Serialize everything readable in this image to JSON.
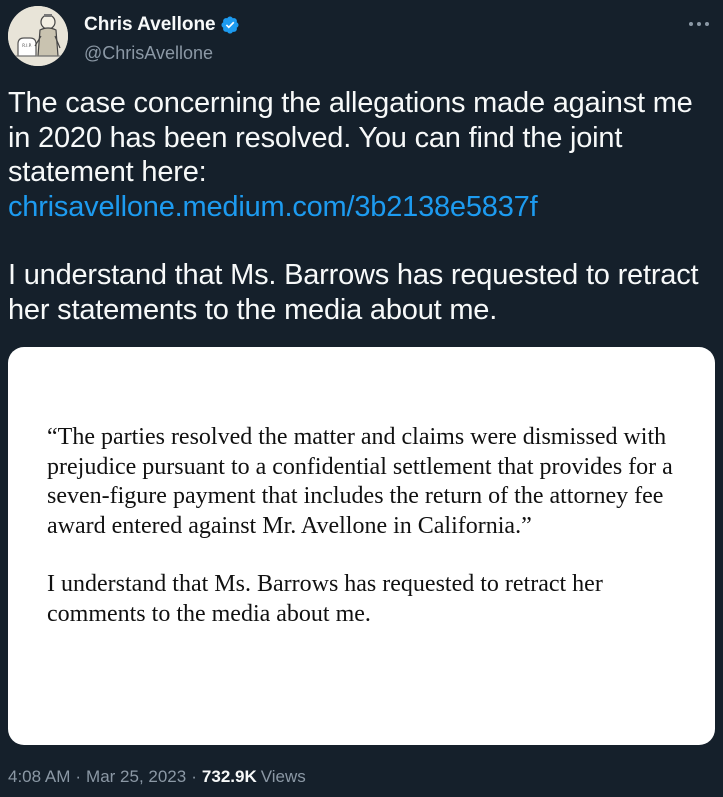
{
  "author": {
    "display_name": "Chris Avellone",
    "handle": "@ChrisAvellone",
    "verified_icon": "verified-badge-icon"
  },
  "tweet": {
    "paragraph1": "The case concerning the allegations made against me in 2020 has been resolved. You can find the joint statement here:",
    "link": "chrisavellone.medium.com/3b2138e5837f",
    "paragraph2": "I understand that Ms. Barrows has requested to retract her statements to the media about me."
  },
  "media": {
    "quote_paragraph1": "“The parties resolved the matter and claims were dismissed with prejudice pursuant to a confidential settlement that provides for a seven-figure payment that includes the return of the attorney fee award entered against Mr. Avellone in California.”",
    "quote_paragraph2": "I understand that Ms. Barrows has requested to retract her comments to the media about me."
  },
  "meta": {
    "time": "4:08 AM",
    "separator": "·",
    "date": "Mar 25, 2023",
    "views_count": "732.9K",
    "views_label": "Views"
  },
  "colors": {
    "background": "#15202b",
    "text": "#f7f9f9",
    "secondary_text": "#8b98a5",
    "link": "#1d9bf0"
  }
}
